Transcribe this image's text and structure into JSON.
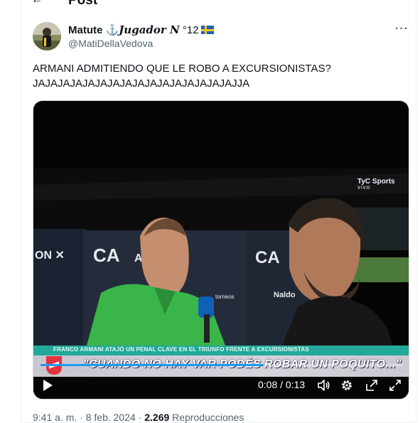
{
  "header": {
    "title": "Post",
    "back_icon": "back-arrow-icon"
  },
  "tweet": {
    "author": {
      "name_prefix": "Matute",
      "name_fancy": "𝑱𝒖𝒈𝒂𝒅𝒐𝒓 𝑵",
      "name_number": "°12",
      "anchor_icon": "⚓",
      "flag_icon": "sweden-flag-icon",
      "handle": "@MatiDellaVedova"
    },
    "more_icon": "more-options-icon",
    "text_lines": [
      "ARMANI ADMITIENDO QUE LE ROBO A EXCURSIONISTAS?",
      "JAJAJAJAJAJAJAJAJAJAJAJAJAJAJAJAJJA"
    ],
    "video": {
      "broadcaster": "TyC Sports",
      "broadcaster_sub": "VIVO",
      "lower_third": "FRANCO ARMANI ATAJÓ UN PENAL CLAVE EN EL TRIUNFO FRENTE A EXCURSIONISTAS",
      "caption": "\"CUANDO NO HAY VAR PODÉS ROBAR UN POQUITO...\"",
      "time_current": "0:08",
      "time_separator": "/",
      "time_total": "0:13",
      "progress_fraction": 0.615,
      "controls": {
        "play": "play-icon",
        "volume": "volume-icon",
        "settings": "settings-gear-icon",
        "popout": "popout-icon",
        "fullscreen": "fullscreen-icon"
      }
    },
    "meta": {
      "time": "9:41 a. m.",
      "separator": "·",
      "date": "8 feb. 2024",
      "views_count": "2.269",
      "views_label": "Reproducciones"
    }
  },
  "colors": {
    "accent": "#1d9bf0",
    "text_primary": "#0f1419",
    "text_secondary": "#536471",
    "lower_third": "#23a99a"
  }
}
